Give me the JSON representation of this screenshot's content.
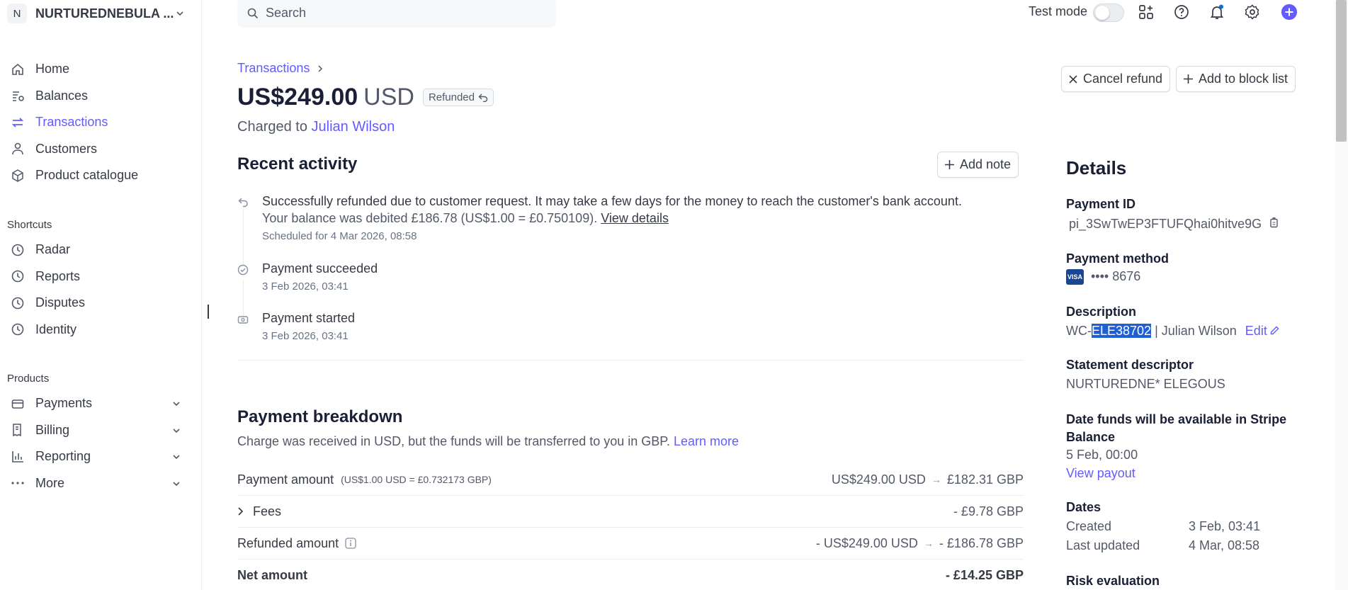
{
  "account": {
    "initial": "N",
    "name": "NURTUREDNEBULA ..."
  },
  "sidebar": {
    "main": [
      {
        "label": "Home",
        "icon": "home-icon"
      },
      {
        "label": "Balances",
        "icon": "balances-icon"
      },
      {
        "label": "Transactions",
        "icon": "transactions-icon",
        "active": true
      },
      {
        "label": "Customers",
        "icon": "customers-icon"
      },
      {
        "label": "Product catalogue",
        "icon": "product-icon"
      }
    ],
    "shortcuts_title": "Shortcuts",
    "shortcuts": [
      {
        "label": "Radar",
        "icon": "clock-icon"
      },
      {
        "label": "Reports",
        "icon": "clock-icon"
      },
      {
        "label": "Disputes",
        "icon": "clock-icon"
      },
      {
        "label": "Identity",
        "icon": "clock-icon"
      }
    ],
    "products_title": "Products",
    "products": [
      {
        "label": "Payments",
        "icon": "payments-icon"
      },
      {
        "label": "Billing",
        "icon": "billing-icon"
      },
      {
        "label": "Reporting",
        "icon": "reporting-icon"
      },
      {
        "label": "More",
        "icon": "more-icon"
      }
    ]
  },
  "topbar": {
    "search_placeholder": "Search",
    "test_mode_label": "Test mode",
    "test_mode_on": false
  },
  "breadcrumb": {
    "parent": "Transactions"
  },
  "header": {
    "amount": "US$249.00",
    "currency": "USD",
    "status": "Refunded",
    "charged_to_prefix": "Charged to",
    "customer": "Julian Wilson",
    "cancel_refund": "Cancel refund",
    "add_block": "Add to block list"
  },
  "activity": {
    "title": "Recent activity",
    "add_note": "Add note",
    "items": [
      {
        "icon": "refund-icon",
        "text": "Successfully refunded due to customer request. It may take a few days for the money to reach the customer's bank account.",
        "text2": "Your balance was debited £186.78 (US$1.00 = £0.750109).",
        "link": "View details",
        "sub": "Scheduled for 4 Mar 2026, 08:58"
      },
      {
        "icon": "check-circle-icon",
        "text": "Payment succeeded",
        "sub": "3 Feb 2026, 03:41"
      },
      {
        "icon": "payment-started-icon",
        "text": "Payment started",
        "sub": "3 Feb 2026, 03:41"
      }
    ]
  },
  "breakdown": {
    "title": "Payment breakdown",
    "subtitle": "Charge was received in USD, but the funds will be transferred to you in GBP.",
    "learn_more": "Learn more",
    "rows": [
      {
        "label": "Payment amount",
        "note": "(US$1.00 USD = £0.732173 GBP)",
        "from": "US$249.00 USD",
        "to": "£182.31 GBP"
      },
      {
        "label": "Fees",
        "value": "- £9.78 GBP"
      },
      {
        "label": "Refunded amount",
        "from": "- US$249.00 USD",
        "to": "- £186.78 GBP"
      },
      {
        "label": "Net amount",
        "value": "- £14.25 GBP"
      }
    ]
  },
  "details": {
    "title": "Details",
    "payment_id_label": "Payment ID",
    "payment_id": "pi_3SwTwEP3FTUFQhai0hitve9G",
    "payment_method_label": "Payment method",
    "card_brand": "VISA",
    "card_last4": "•••• 8676",
    "description_label": "Description",
    "description_prefix": "WC-",
    "description_selected": "ELE38702",
    "description_suffix": " | Julian Wilson",
    "edit": "Edit",
    "statement_label": "Statement descriptor",
    "statement": "NURTUREDNE* ELEGOUS",
    "funds_label": "Date funds will be available in Stripe Balance",
    "funds_date": "5 Feb, 00:00",
    "view_payout": "View payout",
    "dates_label": "Dates",
    "created_label": "Created",
    "created": "3 Feb, 03:41",
    "updated_label": "Last updated",
    "updated": "4 Mar, 08:58",
    "risk_label": "Risk evaluation"
  },
  "colors": {
    "accent": "#635bff",
    "selection": "#1f5fd6"
  }
}
